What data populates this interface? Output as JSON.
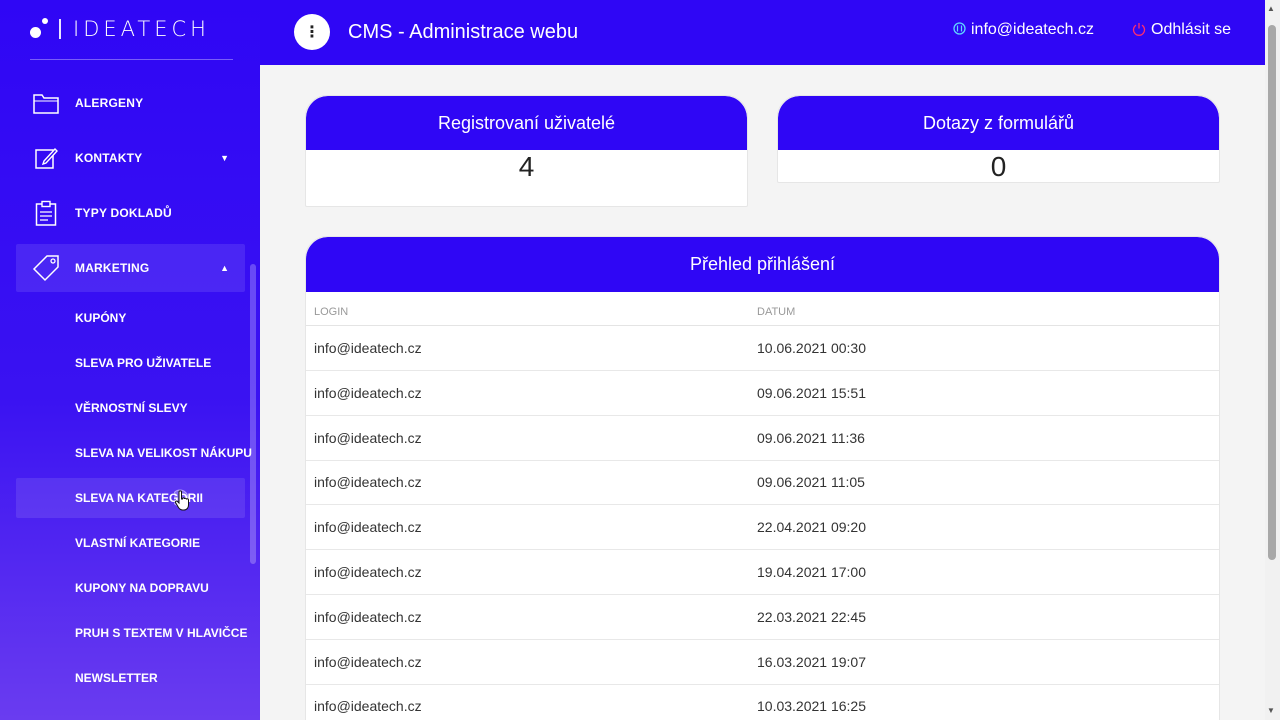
{
  "logo": {
    "text": "IDEATECH"
  },
  "sidebar": {
    "items": [
      {
        "label": "ALERGENY",
        "icon": "folder-icon"
      },
      {
        "label": "KONTAKTY",
        "icon": "edit-icon",
        "caret": "▼"
      },
      {
        "label": "TYPY DOKLADŮ",
        "icon": "clipboard-icon"
      },
      {
        "label": "MARKETING",
        "icon": "tag-icon",
        "caret": "▲"
      }
    ],
    "subitems": [
      {
        "label": "KUPÓNY"
      },
      {
        "label": "SLEVA PRO UŽIVATELE"
      },
      {
        "label": "VĚRNOSTNÍ SLEVY"
      },
      {
        "label": "SLEVA NA VELIKOST NÁKUPU"
      },
      {
        "label": "SLEVA NA KATEGORII"
      },
      {
        "label": "VLASTNÍ KATEGORIE"
      },
      {
        "label": "KUPONY NA DOPRAVU"
      },
      {
        "label": "PRUH S TEXTEM V HLAVIČCE"
      },
      {
        "label": "NEWSLETTER"
      }
    ]
  },
  "header": {
    "menu_glyph": "⋮",
    "title": "CMS - Administrace webu",
    "user_email": "info@ideatech.cz",
    "logout_label": "Odhlásit se"
  },
  "stats": {
    "registered": {
      "title": "Registrovaní uživatelé",
      "value": "4"
    },
    "inquiries": {
      "title": "Dotazy z formulářů",
      "value": "0"
    }
  },
  "logins": {
    "title": "Přehled přihlášení",
    "columns": [
      "LOGIN",
      "DATUM"
    ],
    "rows": [
      [
        "info@ideatech.cz",
        "10.06.2021 00:30"
      ],
      [
        "info@ideatech.cz",
        "09.06.2021 15:51"
      ],
      [
        "info@ideatech.cz",
        "09.06.2021 11:36"
      ],
      [
        "info@ideatech.cz",
        "09.06.2021 11:05"
      ],
      [
        "info@ideatech.cz",
        "22.04.2021 09:20"
      ],
      [
        "info@ideatech.cz",
        "19.04.2021 17:00"
      ],
      [
        "info@ideatech.cz",
        "22.03.2021 22:45"
      ],
      [
        "info@ideatech.cz",
        "16.03.2021 19:07"
      ],
      [
        "info@ideatech.cz",
        "10.03.2021 16:25"
      ]
    ]
  },
  "colors": {
    "brand": "#2f06f5",
    "logout_icon": "#ff2d6f",
    "user_icon": "#5fd3ff"
  }
}
